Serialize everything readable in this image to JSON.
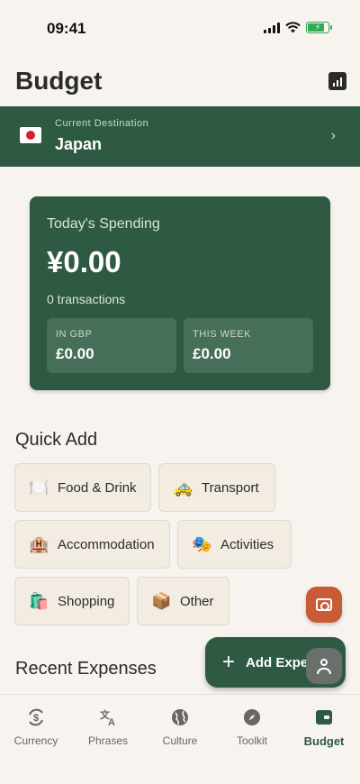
{
  "status_bar": {
    "time": "09:41"
  },
  "header": {
    "title": "Budget"
  },
  "destination": {
    "label": "Current Destination",
    "name": "Japan"
  },
  "spending": {
    "title": "Today's Spending",
    "amount": "¥0.00",
    "transactions": "0 transactions",
    "gbp_label": "IN GBP",
    "gbp_value": "£0.00",
    "week_label": "THIS WEEK",
    "week_value": "£0.00"
  },
  "quick_add": {
    "title": "Quick Add",
    "items": [
      {
        "emoji": "🍽️",
        "label": "Food & Drink"
      },
      {
        "emoji": "🚕",
        "label": "Transport"
      },
      {
        "emoji": "🏨",
        "label": "Accommodation"
      },
      {
        "emoji": "🎭",
        "label": "Activities"
      },
      {
        "emoji": "🛍️",
        "label": "Shopping"
      },
      {
        "emoji": "📦",
        "label": "Other"
      }
    ]
  },
  "add_expense": {
    "label": "Add Expense"
  },
  "recent": {
    "title": "Recent Expenses"
  },
  "nav": {
    "items": [
      {
        "label": "Currency",
        "icon": "currency-exchange-icon"
      },
      {
        "label": "Phrases",
        "icon": "translate-icon"
      },
      {
        "label": "Culture",
        "icon": "globe-icon"
      },
      {
        "label": "Toolkit",
        "icon": "compass-icon"
      },
      {
        "label": "Budget",
        "icon": "wallet-icon"
      }
    ],
    "active": "Budget"
  },
  "colors": {
    "primary": "#2e5a43",
    "background": "#f7f4ef",
    "camera_fab": "#c85c36",
    "chip_bg": "#f2ece3"
  }
}
